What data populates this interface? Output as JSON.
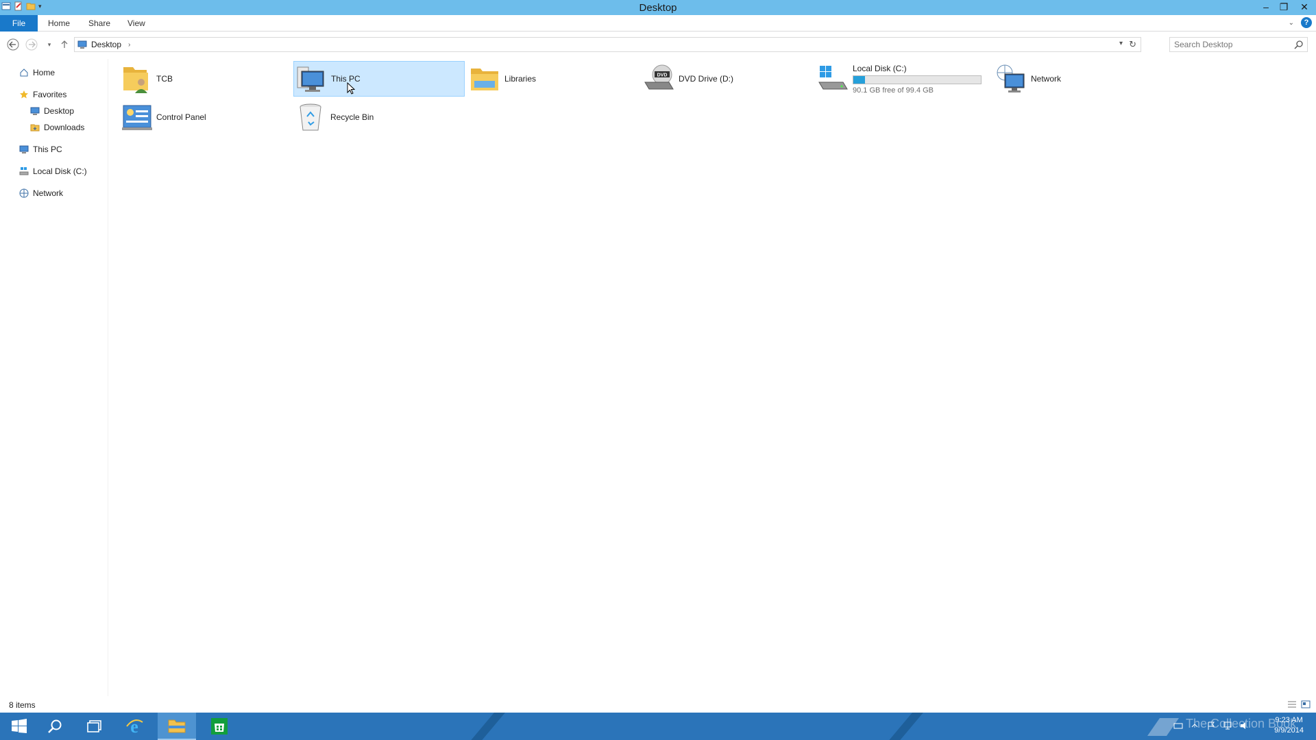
{
  "window": {
    "title": "Desktop",
    "controls": {
      "minimize": "–",
      "restore": "❐",
      "close": "✕"
    }
  },
  "ribbon": {
    "tabs": [
      {
        "label": "File"
      },
      {
        "label": "Home"
      },
      {
        "label": "Share"
      },
      {
        "label": "View"
      }
    ],
    "help": "?"
  },
  "address": {
    "crumb": "Desktop",
    "separator": "›",
    "refresh": "↻"
  },
  "search": {
    "placeholder": "Search Desktop"
  },
  "nav_pane": {
    "items": [
      {
        "label": "Home",
        "icon": "home-icon"
      },
      {
        "label": "Favorites",
        "icon": "star-icon"
      },
      {
        "label": "Desktop",
        "icon": "desktop-icon"
      },
      {
        "label": "Downloads",
        "icon": "folder-icon"
      },
      {
        "label": "This PC",
        "icon": "computer-icon"
      },
      {
        "label": "Local Disk (C:)",
        "icon": "drive-icon"
      },
      {
        "label": "Network",
        "icon": "network-icon"
      }
    ]
  },
  "content": {
    "items": [
      {
        "label": "TCB",
        "icon": "user-folder-icon"
      },
      {
        "label": "This PC",
        "icon": "computer-icon",
        "selected": true
      },
      {
        "label": "Libraries",
        "icon": "libraries-icon"
      },
      {
        "label": "DVD Drive (D:)",
        "icon": "dvd-drive-icon",
        "icon_text": "DVD"
      },
      {
        "label": "Local Disk (C:)",
        "icon": "windows-drive-icon",
        "free_text": "90.1 GB free of 99.4 GB",
        "used_fraction": 0.09
      },
      {
        "label": "Network",
        "icon": "network-icon"
      },
      {
        "label": "Control Panel",
        "icon": "control-panel-icon"
      },
      {
        "label": "Recycle Bin",
        "icon": "recycle-bin-icon"
      }
    ]
  },
  "status": {
    "item_count": "8 items"
  },
  "taskbar": {
    "watermark": "The Collection Book",
    "clock": {
      "time": "9:23 AM",
      "date": "9/9/2014"
    }
  },
  "colors": {
    "titlebar": "#6dbdeb",
    "file_tab": "#1979ca",
    "selection": "#cce8ff",
    "taskbar": "#2b74b9",
    "drive_fill": "#26a0da"
  }
}
